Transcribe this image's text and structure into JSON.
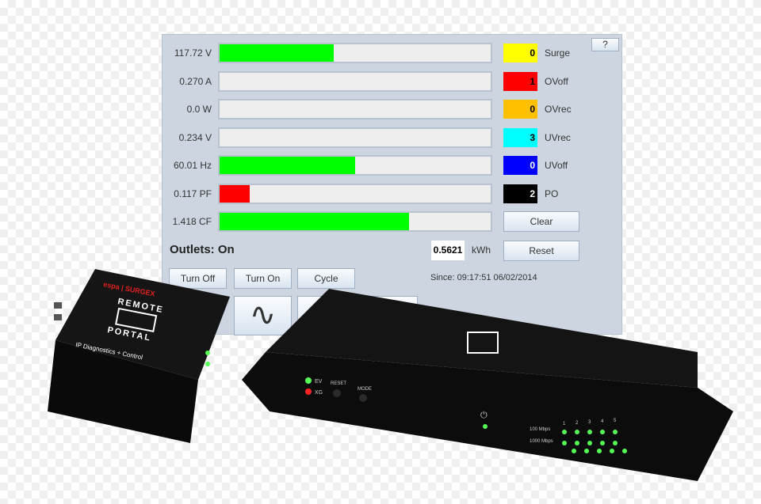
{
  "help_label": "?",
  "meters": [
    {
      "label": "117.72 V",
      "fill": 0.42,
      "color": "#00ff00"
    },
    {
      "label": "0.270 A",
      "fill": 0,
      "color": "#00ff00"
    },
    {
      "label": "0.0 W",
      "fill": 0,
      "color": "#00ff00"
    },
    {
      "label": "0.234 V",
      "fill": 0,
      "color": "#00ff00"
    },
    {
      "label": "60.01 Hz",
      "fill": 0.5,
      "color": "#00ff00"
    },
    {
      "label": "0.117 PF",
      "fill": 0.11,
      "color": "#ff0000"
    },
    {
      "label": "1.418 CF",
      "fill": 0.7,
      "color": "#00ff00"
    }
  ],
  "counters": [
    {
      "value": "0",
      "label": "Surge",
      "color": "#ffff00",
      "text": "#000"
    },
    {
      "value": "1",
      "label": "OVoff",
      "color": "#ff0000",
      "text": "#000"
    },
    {
      "value": "0",
      "label": "OVrec",
      "color": "#ffc000",
      "text": "#000"
    },
    {
      "value": "3",
      "label": "UVrec",
      "color": "#00ffff",
      "text": "#000"
    },
    {
      "value": "0",
      "label": "UVoff",
      "color": "#0000ff",
      "text": "#fff"
    },
    {
      "value": "2",
      "label": "PO",
      "color": "#000000",
      "text": "#fff"
    }
  ],
  "clear_label": "Clear",
  "reset_label": "Reset",
  "outlets_status": "Outlets: On",
  "energy": {
    "value": "0.5621",
    "unit": "kWh"
  },
  "since": "Since: 09:17:51 06/02/2014",
  "buttons": {
    "turn_off": "Turn Off",
    "turn_on": "Turn On",
    "cycle": "Cycle"
  },
  "devices": {
    "small": {
      "brand": "espa | SURGEX",
      "line1": "REMOTE",
      "line2": "PORTAL",
      "subtitle": "IP Diagnostics + Control"
    },
    "large": {
      "ev": "EV",
      "xg": "XG",
      "reset": "RESET",
      "mode": "MODE",
      "speed100": "100 Mbps",
      "speed1000": "1000 Mbps",
      "ports": [
        "1",
        "2",
        "3",
        "4",
        "5"
      ]
    }
  }
}
